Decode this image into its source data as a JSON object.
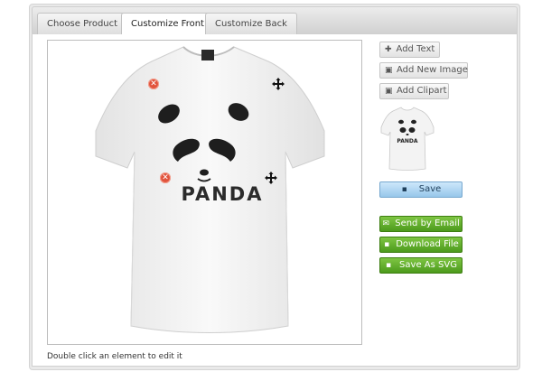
{
  "tabs": [
    {
      "label": "Choose Product",
      "active": false
    },
    {
      "label": "Customize Front",
      "active": true
    },
    {
      "label": "Customize Back",
      "active": false
    }
  ],
  "design": {
    "text": "PANDA",
    "hint": "Double click an element to edit it"
  },
  "tools": {
    "add_text": "Add Text",
    "add_image": "Add New Image",
    "add_clipart": "Add Clipart"
  },
  "actions": {
    "save": "Save",
    "send_email": "Send by Email",
    "download": "Download File",
    "save_svg": "Save As SVG"
  },
  "icons": {
    "add_text": "plus-icon",
    "add_image": "image-icon",
    "add_clipart": "clipart-icon",
    "save": "floppy-icon",
    "email": "envelope-icon",
    "download": "floppy-icon",
    "svg": "floppy-icon",
    "remove": "remove-icon",
    "move": "move-icon"
  },
  "colors": {
    "save_button": "#a9d3f1",
    "green_buttons": "#5aa72a",
    "remove_handle": "#e1533c"
  }
}
